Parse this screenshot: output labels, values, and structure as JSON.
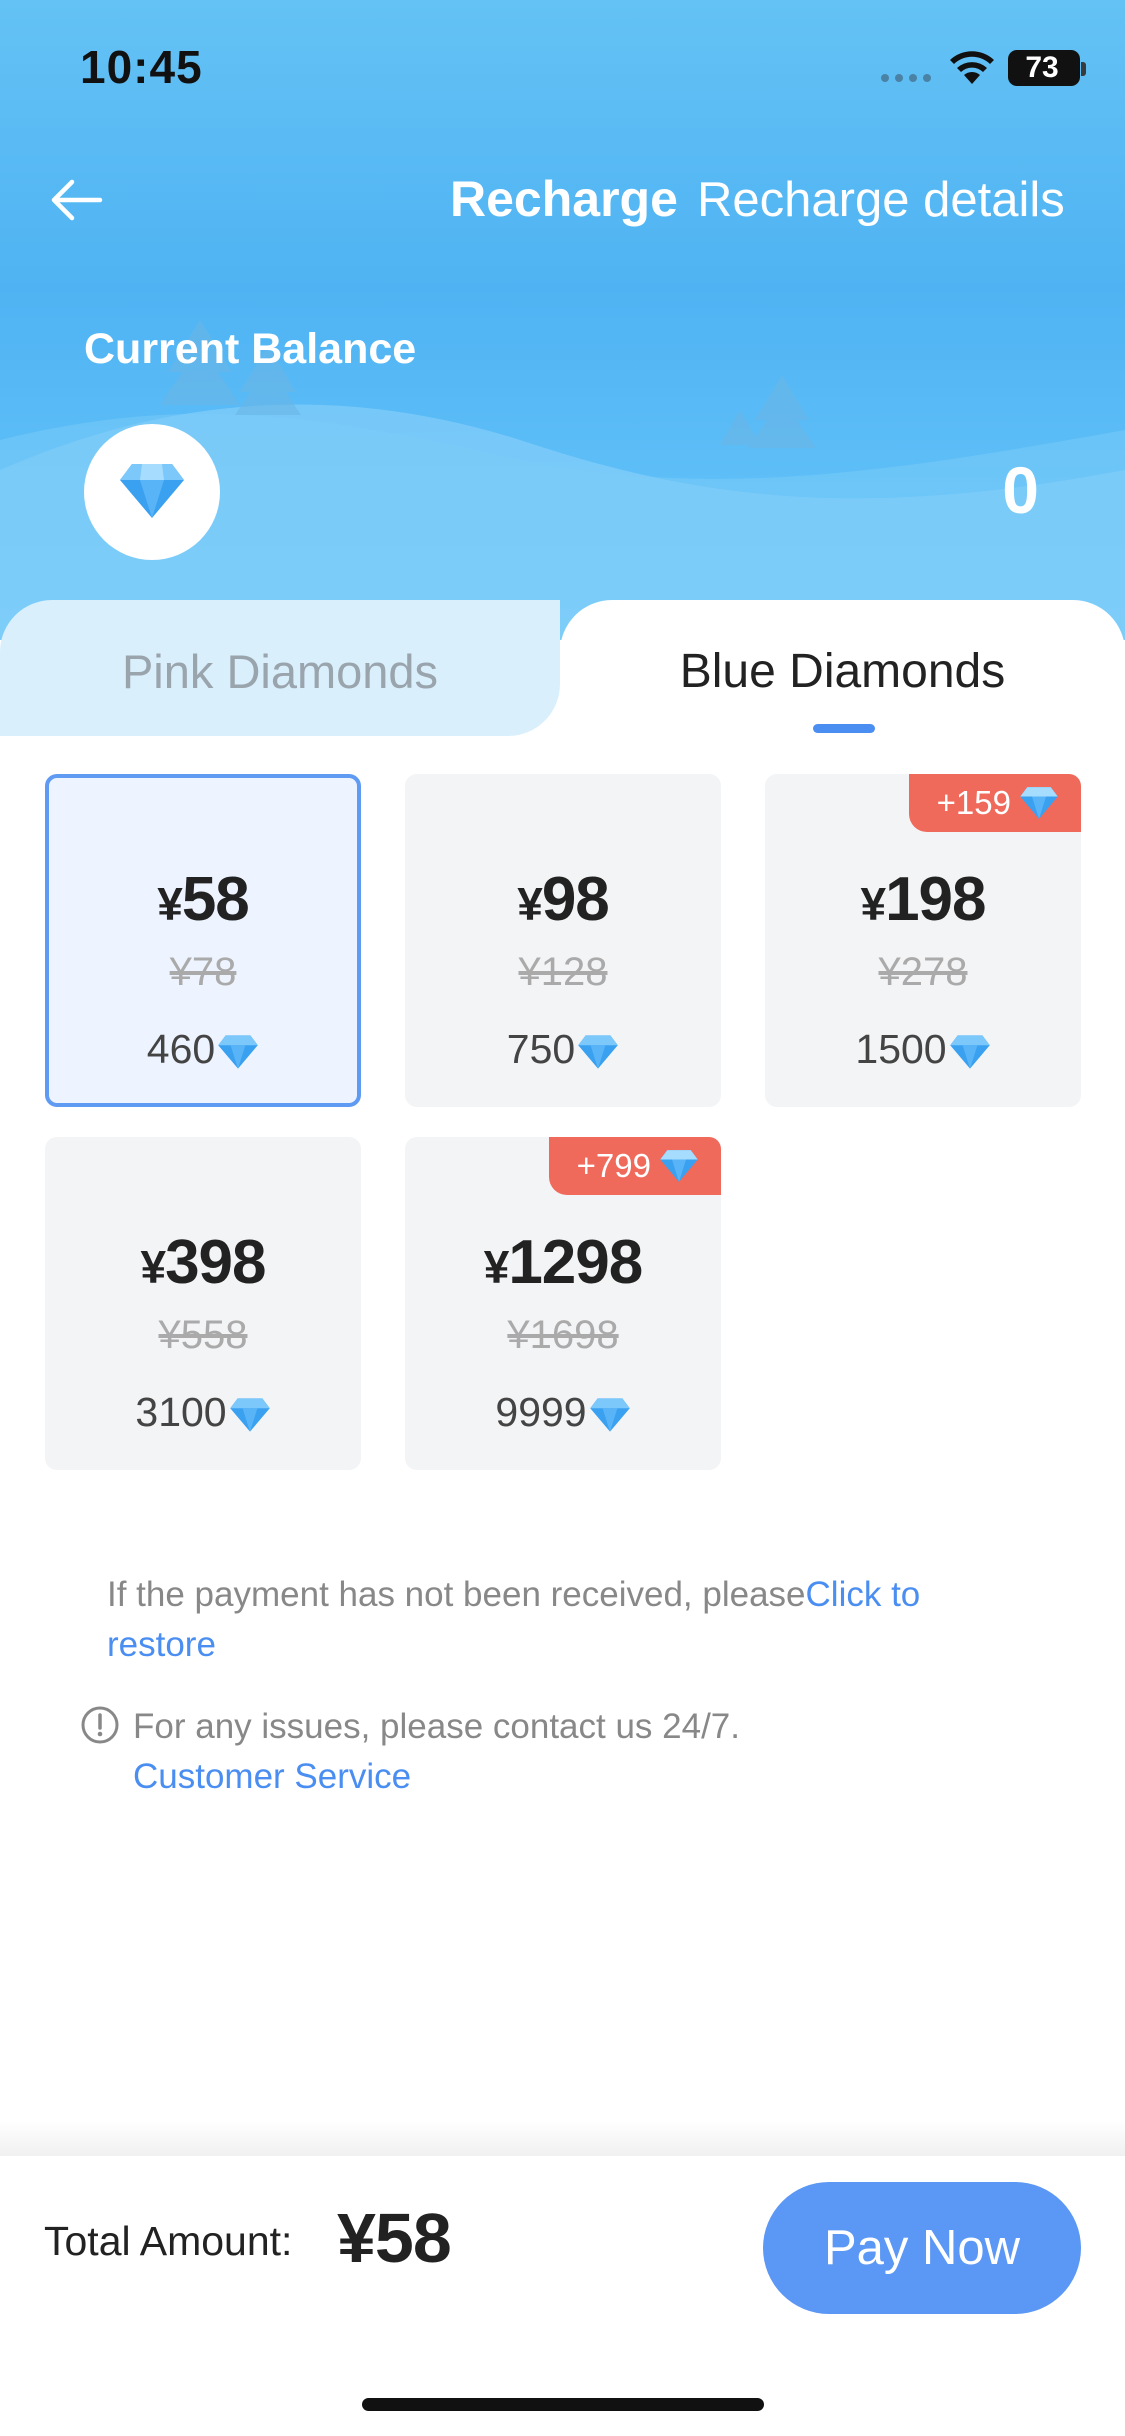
{
  "status_bar": {
    "time": "10:45",
    "battery": "73"
  },
  "nav": {
    "title": "Recharge",
    "details_link": "Recharge details"
  },
  "balance": {
    "label": "Current Balance",
    "value": "0"
  },
  "tabs": [
    {
      "label": "Pink Diamonds",
      "active": false
    },
    {
      "label": "Blue Diamonds",
      "active": true
    }
  ],
  "packages": [
    {
      "currency": "¥",
      "price": "58",
      "original": "¥78",
      "amount": "460",
      "bonus": "",
      "selected": true
    },
    {
      "currency": "¥",
      "price": "98",
      "original": "¥128",
      "amount": "750",
      "bonus": "",
      "selected": false
    },
    {
      "currency": "¥",
      "price": "198",
      "original": "¥278",
      "amount": "1500",
      "bonus": "+159",
      "selected": false
    },
    {
      "currency": "¥",
      "price": "398",
      "original": "¥558",
      "amount": "3100",
      "bonus": "",
      "selected": false
    },
    {
      "currency": "¥",
      "price": "1298",
      "original": "¥1698",
      "amount": "9999",
      "bonus": "+799",
      "selected": false
    }
  ],
  "notes": {
    "restore_text": "If the payment has not been received, please",
    "restore_link": "Click to restore",
    "contact_text": "For any issues, please contact us 24/7.",
    "contact_link": "Customer Service"
  },
  "footer": {
    "total_label": "Total Amount:",
    "total_value": "¥58",
    "pay_button": "Pay Now"
  },
  "colors": {
    "accent": "#5b97f4",
    "badge": "#f06a5c",
    "header": "#4fb3f3"
  },
  "icons": {
    "back": "arrow-left-icon",
    "diamond": "diamond-icon",
    "info": "info-circle-icon"
  }
}
